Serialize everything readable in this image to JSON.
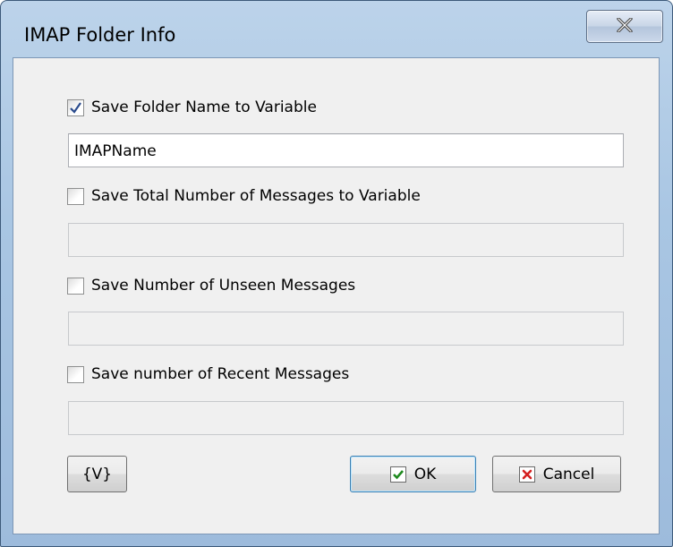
{
  "window": {
    "title": "IMAP Folder Info",
    "close_icon": "close-icon"
  },
  "options": [
    {
      "label": "Save Folder Name to Variable",
      "checked": true,
      "value": "IMAPName",
      "enabled": true
    },
    {
      "label": "Save Total Number of Messages to Variable",
      "checked": false,
      "value": "",
      "enabled": false
    },
    {
      "label": "Save Number of Unseen Messages",
      "checked": false,
      "value": "",
      "enabled": false
    },
    {
      "label": "Save number of Recent Messages",
      "checked": false,
      "value": "",
      "enabled": false
    }
  ],
  "buttons": {
    "variables_label": "{V}",
    "ok_label": "OK",
    "ok_icon": "check-icon",
    "cancel_label": "Cancel",
    "cancel_icon": "x-icon"
  },
  "colors": {
    "frame": "#a9c6e3",
    "client": "#f0f0f0",
    "check_mark": "#2a4b8d",
    "ok_icon": "#1f8a1f",
    "cancel_icon": "#d42020"
  }
}
